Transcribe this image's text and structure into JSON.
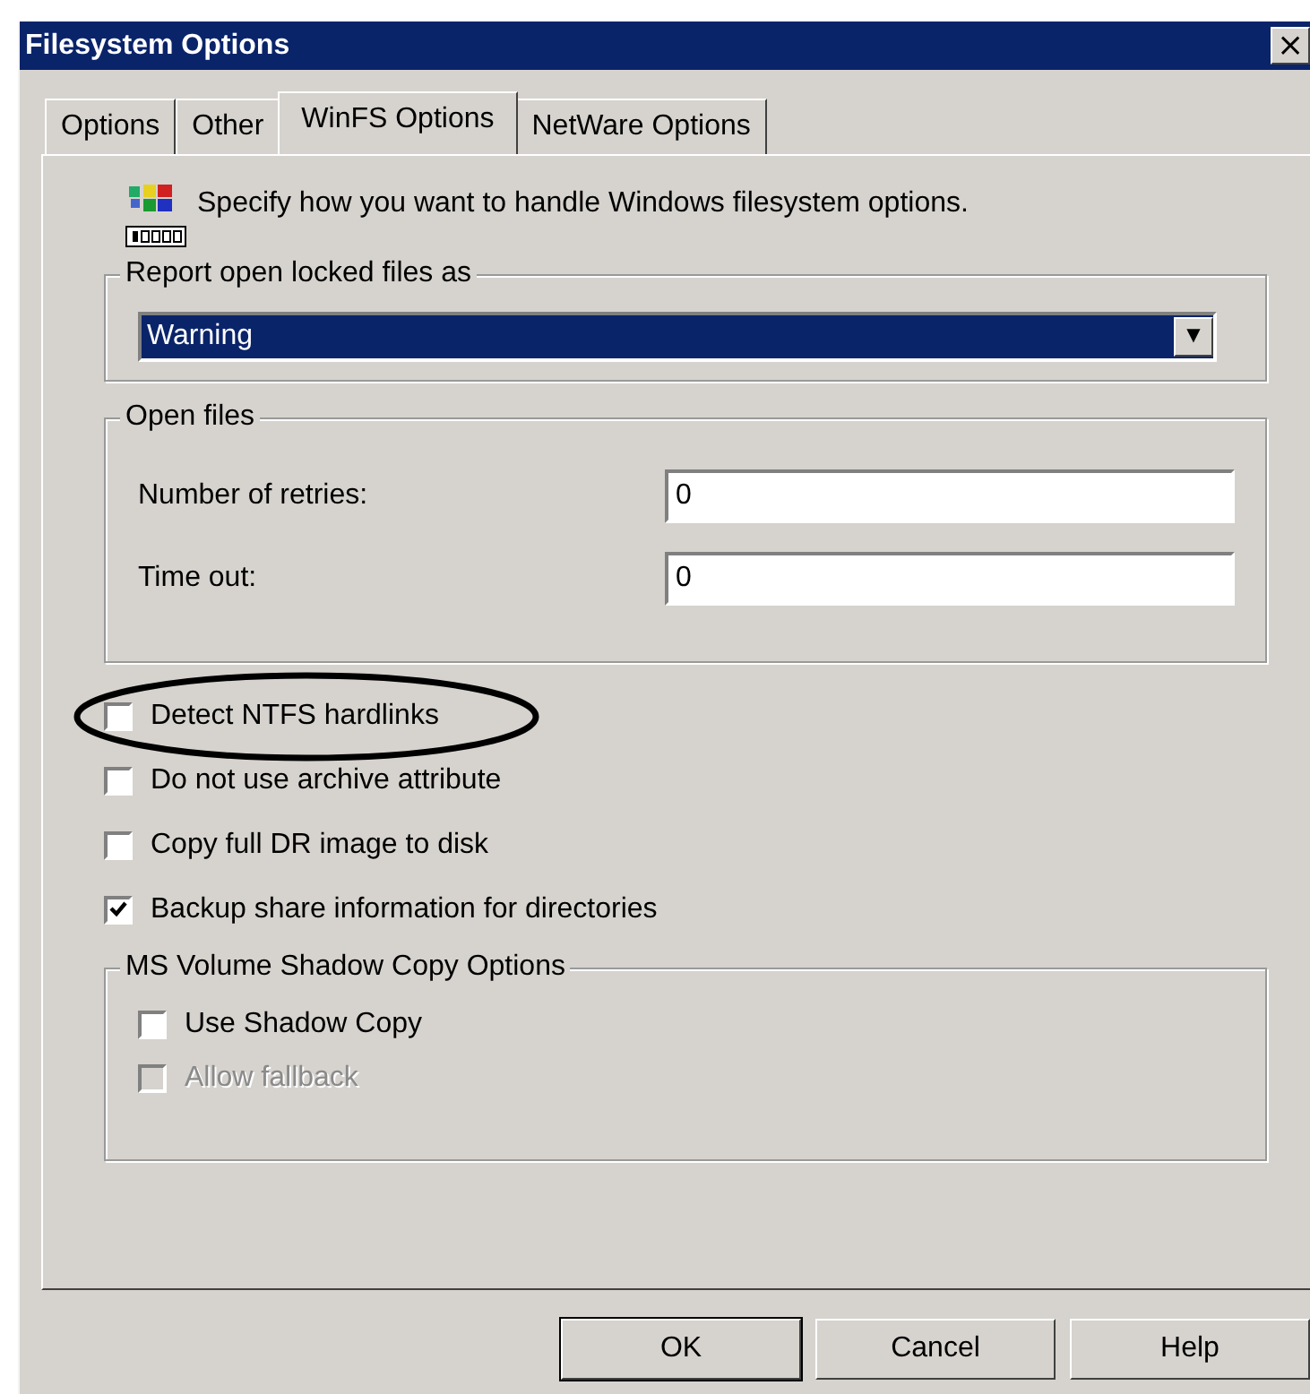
{
  "window": {
    "title": "Filesystem Options",
    "close": "×"
  },
  "tabs": [
    {
      "label": "Options",
      "selected": false
    },
    {
      "label": "Other",
      "selected": false
    },
    {
      "label": "WinFS Options",
      "selected": true
    },
    {
      "label": "NetWare Options",
      "selected": false
    }
  ],
  "intro": "Specify how you want to handle Windows filesystem options.",
  "report_group": {
    "title": "Report open locked files as",
    "dropdown": {
      "value": "Warning",
      "arrow": "▼"
    }
  },
  "open_files_group": {
    "title": "Open files",
    "fields": [
      {
        "label": "Number of retries:",
        "value": "0"
      },
      {
        "label": "Time out:",
        "value": "0"
      }
    ]
  },
  "checkboxes": [
    {
      "label": "Detect NTFS hardlinks",
      "checked": false,
      "disabled": false,
      "circled": true
    },
    {
      "label": "Do not use archive attribute",
      "checked": false,
      "disabled": false,
      "circled": false
    },
    {
      "label": "Copy full DR image to disk",
      "checked": false,
      "disabled": false,
      "circled": false
    },
    {
      "label": "Backup share information for directories",
      "checked": true,
      "disabled": false,
      "circled": false
    }
  ],
  "shadow_group": {
    "title": "MS Volume Shadow Copy Options",
    "checkboxes": [
      {
        "label": "Use Shadow Copy",
        "checked": false,
        "disabled": false
      },
      {
        "label": "Allow fallback",
        "checked": false,
        "disabled": true
      }
    ]
  },
  "buttons": [
    {
      "label": "OK",
      "default": true
    },
    {
      "label": "Cancel",
      "default": false
    },
    {
      "label": "Help",
      "default": false
    }
  ]
}
